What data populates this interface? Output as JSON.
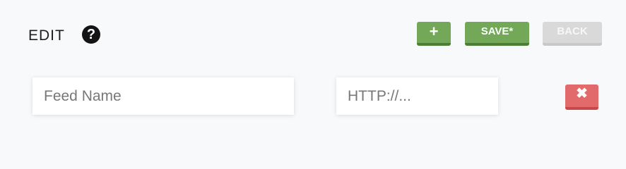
{
  "header": {
    "title": "EDIT",
    "help_icon": "question-circle-icon",
    "help_glyph": "?"
  },
  "toolbar": {
    "add_label": "+",
    "save_label": "SAVE*",
    "back_label": "BACK"
  },
  "form": {
    "name_placeholder": "Feed Name",
    "name_value": "",
    "url_placeholder": "HTTP://...",
    "url_value": "",
    "remove_label": "✖",
    "remove_icon": "close-icon"
  },
  "colors": {
    "add_button": "#72a857",
    "save_button": "#72a857",
    "back_button_disabled": "#d9d9d9",
    "remove_button": "#e26a6a",
    "background": "#f8f9fb"
  }
}
